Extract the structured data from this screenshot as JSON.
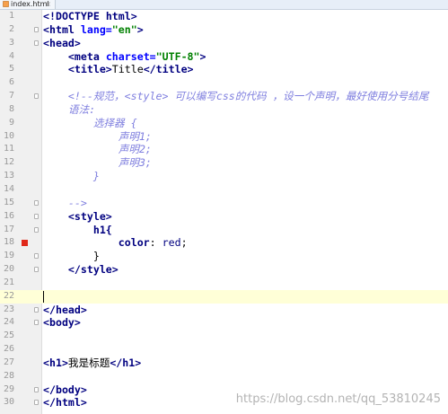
{
  "tab": {
    "filename": "index.html",
    "close_glyph": "×",
    "icon": "html-file-icon"
  },
  "lines": {
    "n1": "1",
    "n2": "2",
    "n3": "3",
    "n4": "4",
    "n5": "5",
    "n6": "6",
    "n7": "7",
    "n8": "8",
    "n9": "9",
    "n10": "10",
    "n11": "11",
    "n12": "12",
    "n13": "13",
    "n14": "14",
    "n15": "15",
    "n16": "16",
    "n17": "17",
    "n18": "18",
    "n19": "19",
    "n20": "20",
    "n21": "21",
    "n22": "22",
    "n23": "23",
    "n24": "24",
    "n25": "25",
    "n26": "26",
    "n27": "27",
    "n28": "28",
    "n29": "29",
    "n30": "30"
  },
  "code": {
    "l1a": "<!DOCTYPE ",
    "l1b": "html",
    "l1c": ">",
    "l2a": "<html ",
    "l2b": "lang=",
    "l2c": "\"en\"",
    "l2d": ">",
    "l3": "<head>",
    "l4a": "    <meta ",
    "l4b": "charset=",
    "l4c": "\"UTF-8\"",
    "l4d": ">",
    "l5a": "    <title>",
    "l5b": "Title",
    "l5c": "</title>",
    "l7": "    <!--规范，<style> 可以编写css的代码 ，设一个声明，最好使用分号结尾",
    "l8": "    语法:",
    "l9": "        选择器 {",
    "l10": "            声明1;",
    "l11": "            声明2;",
    "l12": "            声明3;",
    "l13": "        }",
    "l15": "    -->",
    "l16": "    <style>",
    "l17": "        h1{",
    "l18a": "            color",
    "l18b": ": ",
    "l18c": "red",
    "l18d": ";",
    "l19": "        }",
    "l20": "    </style>",
    "l23": "</head>",
    "l24": "<body>",
    "l27a": "<h1>",
    "l27b": "我是标题",
    "l27c": "</h1>",
    "l29": "</body>",
    "l30": "</html>"
  },
  "watermark": "https://blog.csdn.net/qq_53810245",
  "colors": {
    "tag": "#000080",
    "attribute": "#0000ff",
    "string": "#008000",
    "comment": "#7f7fdf",
    "breakpoint": "#e0281a",
    "current_line": "#ffffd7"
  }
}
